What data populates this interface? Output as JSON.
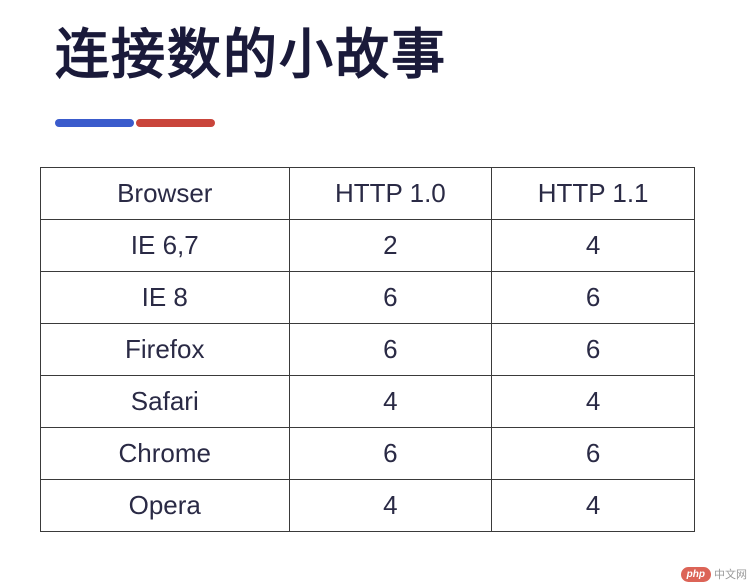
{
  "title": "连接数的小故事",
  "accent": {
    "blue": "#3a5bcc",
    "red": "#c9453b"
  },
  "chart_data": {
    "type": "table",
    "title": "连接数的小故事",
    "columns": [
      "Browser",
      "HTTP 1.0",
      "HTTP 1.1"
    ],
    "rows": [
      {
        "browser": "IE 6,7",
        "http10": 2,
        "http11": 4
      },
      {
        "browser": "IE 8",
        "http10": 6,
        "http11": 6
      },
      {
        "browser": "Firefox",
        "http10": 6,
        "http11": 6
      },
      {
        "browser": "Safari",
        "http10": 4,
        "http11": 4
      },
      {
        "browser": "Chrome",
        "http10": 6,
        "http11": 6
      },
      {
        "browser": "Opera",
        "http10": 4,
        "http11": 4
      }
    ]
  },
  "watermark": {
    "badge": "php",
    "text": "中文网"
  }
}
